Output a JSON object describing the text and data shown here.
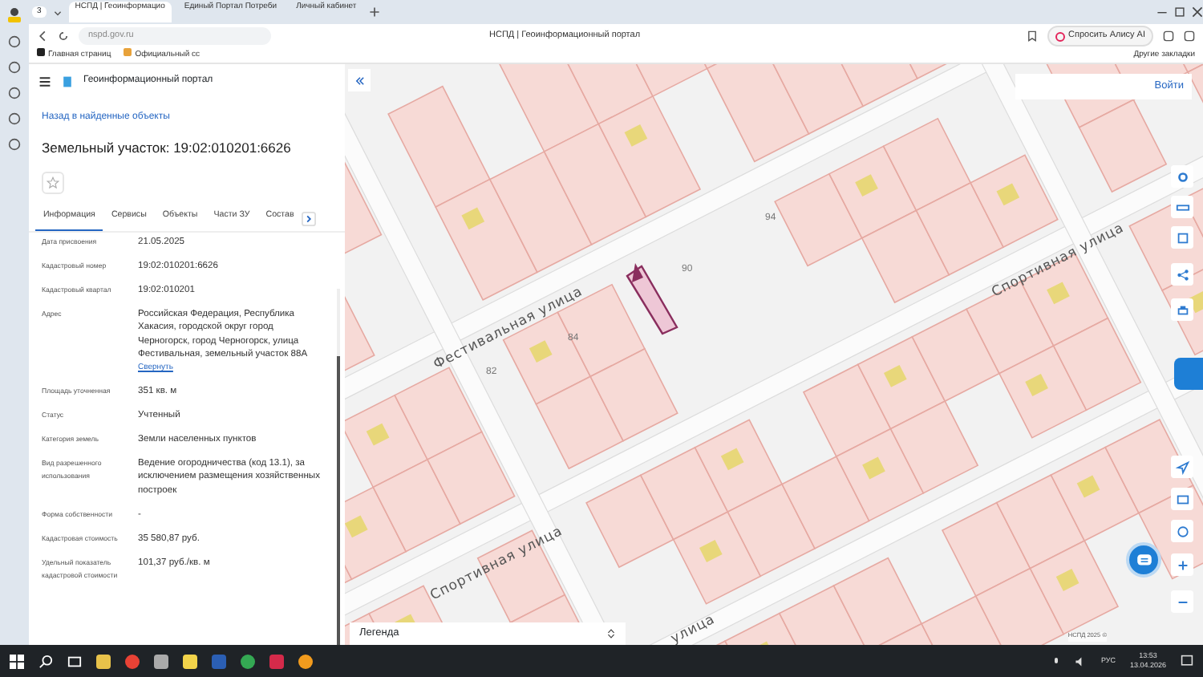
{
  "browser": {
    "tab_count": "3",
    "tabs": [
      {
        "title": "НСПД | Геоинформацио",
        "selected": true
      },
      {
        "title": "Единый Портал Потреби",
        "selected": false
      },
      {
        "title": "Личный кабинет",
        "selected": false
      }
    ],
    "address": "nspd.gov.ru",
    "page_title": "НСПД | Геоинформационный портал",
    "alice_button": "Спросить Алису AI",
    "bookmarks": [
      "Главная страниц",
      "Официальный сс"
    ],
    "other_bookmarks": "Другие закладки"
  },
  "panel": {
    "portal_title": "Геоинформационный портал",
    "back_link": "Назад в найденные объекты",
    "title": "Земельный участок: 19:02:010201:6626",
    "tabs": [
      {
        "label": "Информация",
        "selected": true
      },
      {
        "label": "Сервисы",
        "selected": false
      },
      {
        "label": "Объекты",
        "selected": false
      },
      {
        "label": "Части ЗУ",
        "selected": false
      },
      {
        "label": "Состав",
        "selected": false
      }
    ],
    "properties": [
      {
        "label": "Дата присвоения",
        "value": "21.05.2025"
      },
      {
        "label": "Кадастровый номер",
        "value": "19:02:010201:6626"
      },
      {
        "label": "Кадастровый квартал",
        "value": "19:02:010201"
      },
      {
        "label": "Адрес",
        "value": "Российская Федерация, Республика Хакасия, городской округ город Черногорск, город Черногорск, улица Фестивальная, земельный участок 88А",
        "link": "Свернуть"
      },
      {
        "label": "Площадь уточненная",
        "value": "351 кв. м"
      },
      {
        "label": "Статус",
        "value": "Учтенный"
      },
      {
        "label": "Категория земель",
        "value": "Земли населенных пунктов"
      },
      {
        "label": "Вид разрешенного использования",
        "value": "Ведение огородничества (код 13.1), за исключением размещения хозяйственных построек"
      },
      {
        "label": "Форма собственности",
        "value": "-"
      },
      {
        "label": "Кадастровая стоимость",
        "value": "35 580,87 руб."
      },
      {
        "label": "Удельный показатель кадастровой стоимости",
        "value": "101,37 руб./кв. м"
      }
    ]
  },
  "map": {
    "login_button": "Войти",
    "legend": "Легенда",
    "street_labels": [
      "Фестивальная улица",
      "Спортивная улица",
      "Спортивная улица",
      "улица"
    ],
    "plot_numbers": [
      "94",
      "90",
      "84",
      "82"
    ],
    "attribution": "НСПД 2025 ©"
  },
  "taskbar": {
    "language": "РУС",
    "time": "13:53",
    "date": "13.04.2026"
  }
}
